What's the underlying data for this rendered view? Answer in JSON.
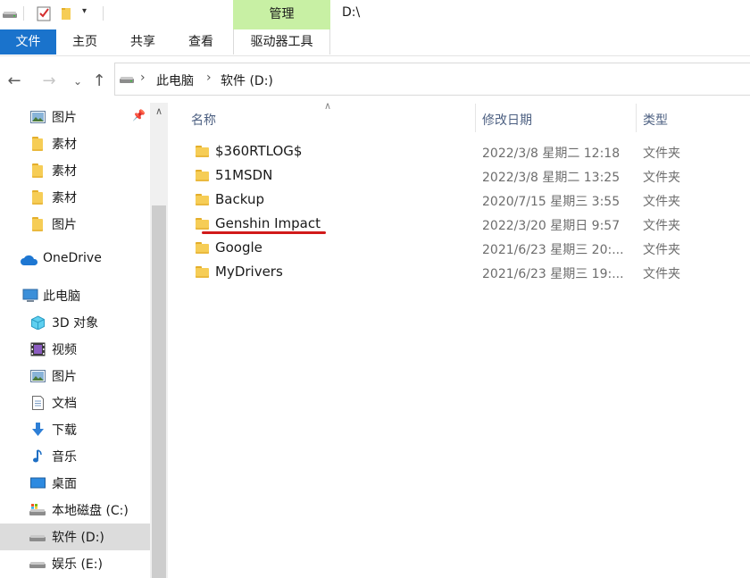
{
  "title_bar": {
    "context_tab": "管理",
    "path": "D:\\"
  },
  "ribbon": {
    "tabs": [
      "文件",
      "主页",
      "共享",
      "查看",
      "驱动器工具"
    ]
  },
  "address": {
    "crumbs": [
      "此电脑",
      "软件 (D:)"
    ]
  },
  "nav_pane": {
    "quick_access": [
      {
        "label": "图片",
        "icon": "pictures-icon"
      },
      {
        "label": "素材",
        "icon": "folder-icon"
      },
      {
        "label": "素材",
        "icon": "folder-icon"
      },
      {
        "label": "素材",
        "icon": "folder-icon"
      },
      {
        "label": "图片",
        "icon": "folder-icon"
      }
    ],
    "onedrive": "OneDrive",
    "this_pc": "此电脑",
    "pc_items": [
      {
        "label": "3D 对象",
        "icon": "3d-objects-icon"
      },
      {
        "label": "视频",
        "icon": "videos-icon"
      },
      {
        "label": "图片",
        "icon": "pictures-icon"
      },
      {
        "label": "文档",
        "icon": "documents-icon"
      },
      {
        "label": "下载",
        "icon": "downloads-icon"
      },
      {
        "label": "音乐",
        "icon": "music-icon"
      },
      {
        "label": "桌面",
        "icon": "desktop-icon"
      },
      {
        "label": "本地磁盘 (C:)",
        "icon": "drive-c-icon"
      },
      {
        "label": "软件 (D:)",
        "icon": "drive-icon"
      },
      {
        "label": "娱乐 (E:)",
        "icon": "drive-icon"
      }
    ]
  },
  "file_list": {
    "columns": [
      "名称",
      "修改日期",
      "类型"
    ],
    "rows": [
      {
        "name": "$360RTLOG$",
        "date": "2022/3/8 星期二 12:18",
        "type": "文件夹"
      },
      {
        "name": "51MSDN",
        "date": "2022/3/8 星期二 13:25",
        "type": "文件夹"
      },
      {
        "name": "Backup",
        "date": "2020/7/15 星期三 3:55",
        "type": "文件夹"
      },
      {
        "name": "Genshin Impact",
        "date": "2022/3/20 星期日 9:57",
        "type": "文件夹"
      },
      {
        "name": "Google",
        "date": "2021/6/23 星期三 20:...",
        "type": "文件夹"
      },
      {
        "name": "MyDrivers",
        "date": "2021/6/23 星期三 19:...",
        "type": "文件夹"
      }
    ]
  },
  "colors": {
    "file_tab": "#1a73cc",
    "context_tab": "#c8f0a4",
    "highlight_underline": "#d11a1a"
  }
}
